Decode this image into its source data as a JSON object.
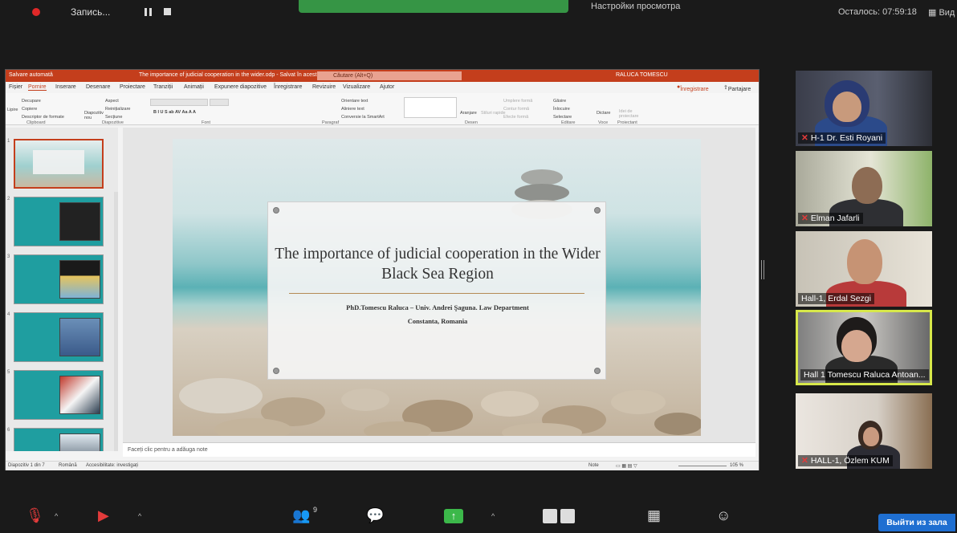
{
  "zoom": {
    "recording_label": "Запись...",
    "view_options": "Настройки просмотра",
    "time_remaining": "Осталось: 07:59:18",
    "layout_label": "Вид",
    "leave_button": "Выйти из зала",
    "participants_count": "9",
    "colors": {
      "share_green": "#3cb84a",
      "recording_red": "#e02828",
      "speaker_highlight": "#d7e84a",
      "leave_blue": "#1f6fd1"
    }
  },
  "ppt": {
    "autosave": "Salvare automată",
    "document_title": "The importance of judicial cooperation in the wider.odp - Salvat în acest PC",
    "search_placeholder": "Căutare (Alt+Q)",
    "user": "RALUCA TOMESCU",
    "tabs": [
      "Fișier",
      "Pornire",
      "Inserare",
      "Desenare",
      "Proiectare",
      "Tranziții",
      "Animații",
      "Expunere diapozitive",
      "Înregistrare",
      "Revizuire",
      "Vizualizare",
      "Ajutor"
    ],
    "active_tab": "Pornire",
    "record_button": "Înregistrare",
    "share_button": "Partajare",
    "ribbon": {
      "clipboard": {
        "label": "Clipboard",
        "paste": "Lipire",
        "cut": "Decupare",
        "copy": "Copiere",
        "format": "Descriptor de formate"
      },
      "slides": {
        "label": "Diapozitive",
        "new": "Diapozitiv nou",
        "layout": "Aspect",
        "reset": "Reinițializare",
        "section": "Secțiune"
      },
      "font": {
        "label": "Font"
      },
      "paragraph": {
        "label": "Paragraf",
        "direction": "Orientare text",
        "align": "Aliniere text",
        "smartart": "Conversie la SmartArt"
      },
      "drawing": {
        "label": "Desen",
        "arrange": "Aranjare",
        "quick_styles": "Stiluri rapide",
        "fill": "Umplere formă",
        "outline": "Contur formă",
        "effects": "Efecte formă"
      },
      "editing": {
        "label": "Editare",
        "find": "Găsire",
        "replace": "Înlocuire",
        "select": "Selectare"
      },
      "voice": {
        "label": "Voce",
        "dictate": "Dictare"
      },
      "designer": {
        "label": "Proiectant",
        "ideas": "Idei de proiectare"
      }
    },
    "slide": {
      "title": "The importance of judicial cooperation in the Wider Black Sea Region",
      "author": "PhD.Tomescu Raluca – Univ. Andrei Şaguna. Law Department",
      "place": "Constanta, Romania"
    },
    "notes_placeholder": "Faceți clic pentru a adăuga note",
    "status": {
      "slide_count": "Diapozitiv 1 din 7",
      "language": "Română",
      "accessibility": "Accesibilitate: investigați",
      "notes": "Note",
      "zoom": "105 %"
    },
    "thumbnails": [
      "1",
      "2",
      "3",
      "4",
      "5",
      "6"
    ],
    "colors": {
      "accent": "#c43e1c",
      "thumb_teal": "#1f9ea0"
    }
  },
  "participants": [
    {
      "name": "H-1 Dr. Esti Royani",
      "muted": true,
      "speaking": false
    },
    {
      "name": "Elman Jafarli",
      "muted": true,
      "speaking": false
    },
    {
      "name": "Hall-1, Erdal Sezgi",
      "muted": false,
      "speaking": false
    },
    {
      "name": "Hall 1 Tomescu Raluca Antoan...",
      "muted": false,
      "speaking": true
    },
    {
      "name": "HALL-1, Özlem KUM",
      "muted": true,
      "speaking": false
    }
  ]
}
